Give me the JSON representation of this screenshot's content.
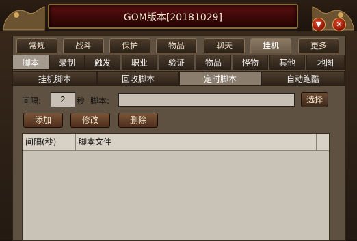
{
  "window": {
    "title": "GOM版本[20181029]",
    "controls": {
      "minimize_icon": "chevron-down-icon",
      "close_icon": "close-icon"
    }
  },
  "top_tabs": [
    {
      "label": "常规"
    },
    {
      "label": "战斗"
    },
    {
      "label": "保护"
    },
    {
      "label": "物品"
    },
    {
      "label": "聊天"
    },
    {
      "label": "挂机",
      "active": true
    },
    {
      "label": "更多"
    }
  ],
  "sub_tabs": [
    {
      "label": "脚本",
      "active": true
    },
    {
      "label": "录制"
    },
    {
      "label": "触发"
    },
    {
      "label": "职业"
    },
    {
      "label": "验证"
    },
    {
      "label": "物品"
    },
    {
      "label": "怪物"
    },
    {
      "label": "其他"
    },
    {
      "label": "地图"
    }
  ],
  "script_tabs": [
    {
      "label": "挂机脚本"
    },
    {
      "label": "回收脚本"
    },
    {
      "label": "定时脚本",
      "active": true
    },
    {
      "label": "自动跑酷"
    }
  ],
  "form": {
    "interval_label": "间隔:",
    "interval_value": "2",
    "seconds_label": "秒",
    "script_label": "脚本:",
    "script_value": "",
    "select_button": "选择"
  },
  "actions": {
    "add": "添加",
    "edit": "修改",
    "delete": "删除"
  },
  "table": {
    "columns": [
      "间隔(秒)",
      "脚本文件"
    ],
    "rows": []
  }
}
